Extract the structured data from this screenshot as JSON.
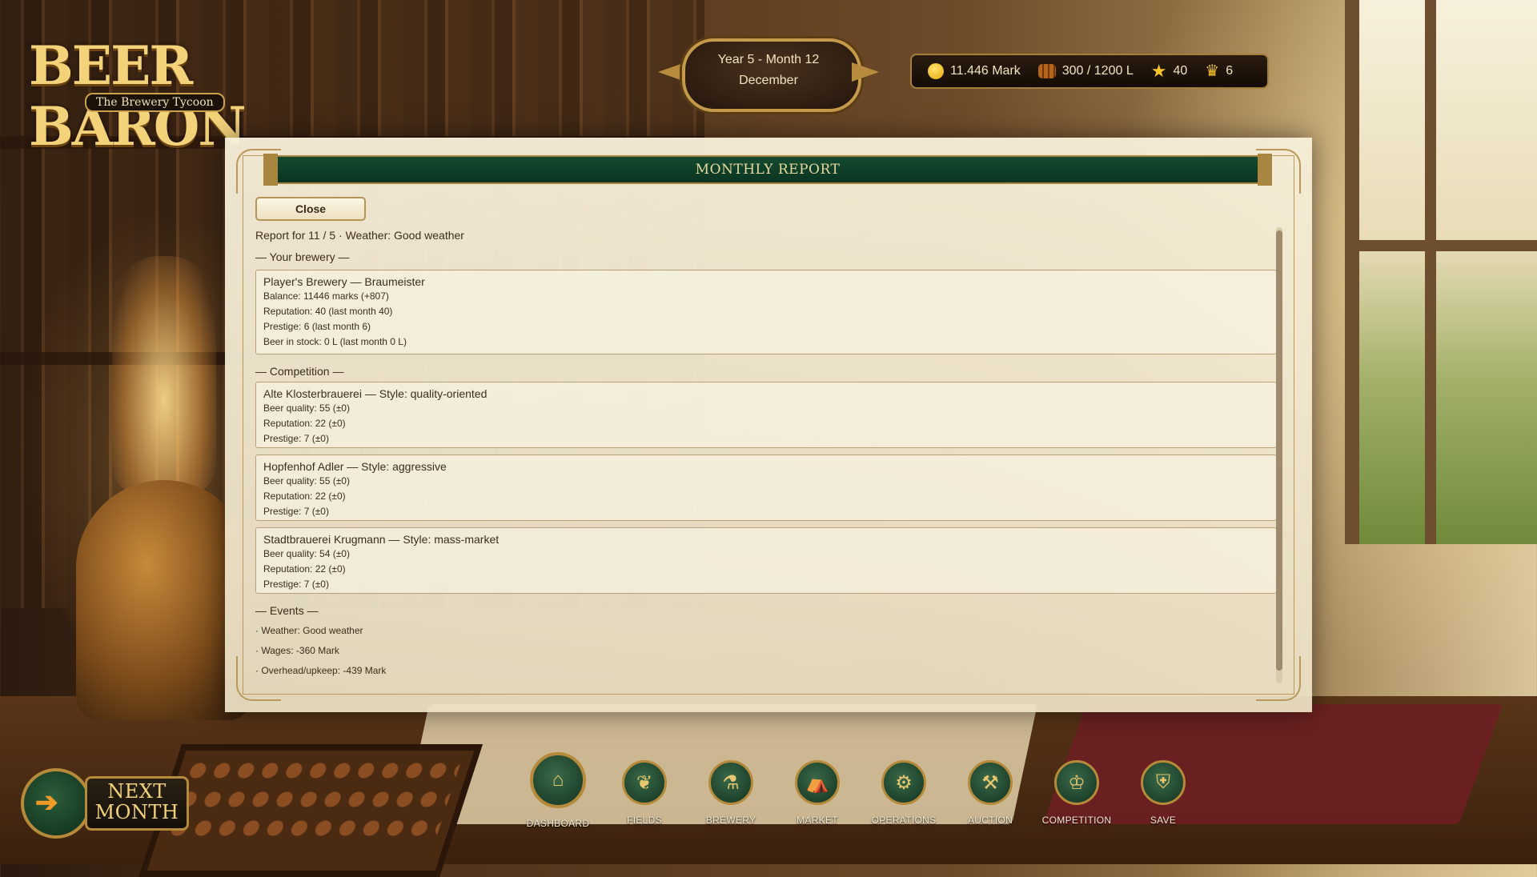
{
  "app": {
    "logo_title": "BEER BARON",
    "logo_subtitle": "The Brewery Tycoon"
  },
  "date": {
    "line1": "Year 5 - Month 12",
    "line2": "December"
  },
  "resources": {
    "money": "11.446 Mark",
    "beer": "300 / 1200 L",
    "reputation": "40",
    "prestige": "6",
    "icons": [
      "coin-icon",
      "barrel-icon",
      "star-icon",
      "crown-icon"
    ]
  },
  "report": {
    "title": "MONTHLY REPORT",
    "close_label": "Close",
    "meta": "Report for 11 / 5  ·  Weather: Good weather",
    "section_brewery": "— Your brewery —",
    "player": {
      "header": "Player's Brewery — Braumeister",
      "lines": [
        "Balance: 11446 marks (+807)",
        "Reputation: 40 (last month 40)",
        "Prestige: 6 (last month 6)",
        "Beer in stock: 0 L (last month 0 L)"
      ]
    },
    "section_competition": "— Competition —",
    "competitors": [
      {
        "header": "Alte Klosterbrauerei — Style: quality-oriented",
        "lines": [
          "Beer quality: 55 (±0)",
          "Reputation: 22 (±0)",
          "Prestige: 7 (±0)"
        ]
      },
      {
        "header": "Hopfenhof Adler — Style: aggressive",
        "lines": [
          "Beer quality: 55 (±0)",
          "Reputation: 22 (±0)",
          "Prestige: 7 (±0)"
        ]
      },
      {
        "header": "Stadtbrauerei Krugmann — Style: mass-market",
        "lines": [
          "Beer quality: 54 (±0)",
          "Reputation: 22 (±0)",
          "Prestige: 7 (±0)"
        ]
      }
    ],
    "section_events": "— Events —",
    "events": [
      "· Weather: Good weather",
      "· Wages: -360 Mark",
      "· Overhead/upkeep: -439 Mark"
    ]
  },
  "next_month": {
    "line1": "NEXT",
    "line2": "MONTH"
  },
  "nav": [
    {
      "label": "DASHBOARD",
      "icon": "house-icon"
    },
    {
      "label": "FIELDS",
      "icon": "wheat-icon"
    },
    {
      "label": "BREWERY",
      "icon": "brewery-icon"
    },
    {
      "label": "MARKET",
      "icon": "market-icon"
    },
    {
      "label": "OPERATIONS",
      "icon": "gears-icon"
    },
    {
      "label": "AUCTION",
      "icon": "gavel-icon"
    },
    {
      "label": "COMPETITION",
      "icon": "laurel-icon"
    },
    {
      "label": "SAVE",
      "icon": "shield-icon"
    }
  ],
  "colors": {
    "panel_bg": "#f3ead3",
    "title_green": "#134a30",
    "gold": "#b58a3a",
    "text": "#3d2d1c"
  }
}
